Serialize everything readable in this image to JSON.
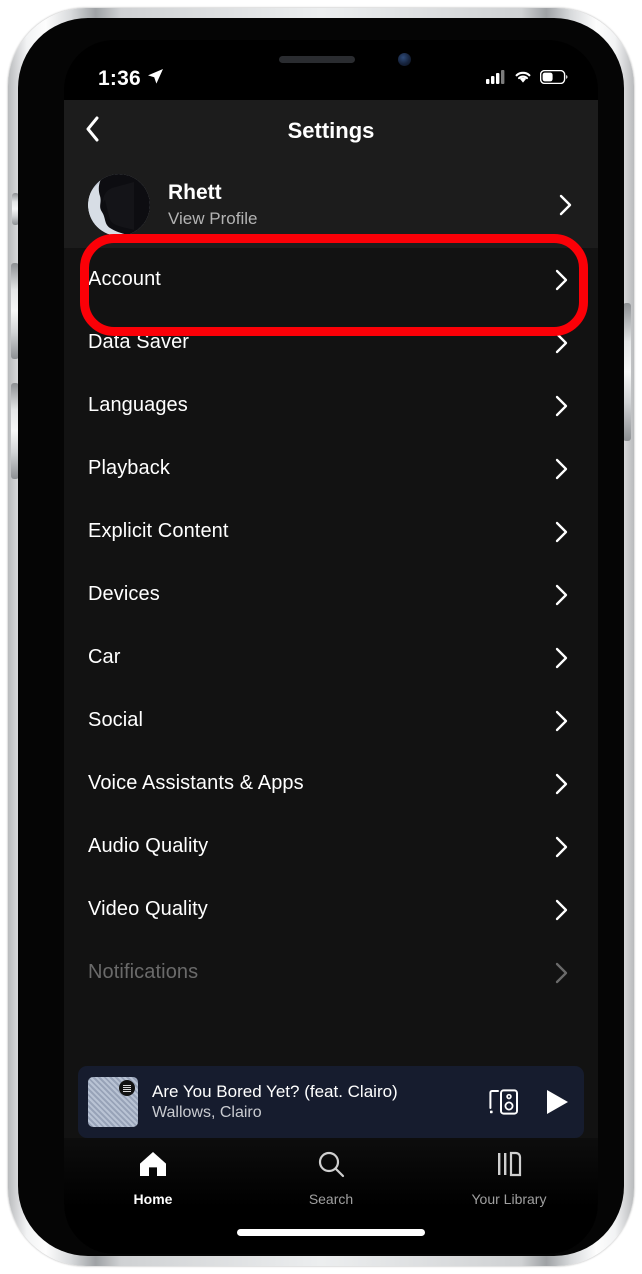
{
  "status_bar": {
    "time": "1:36",
    "location_icon": "location-arrow-icon",
    "cellular_icon": "cellular-bars-icon",
    "wifi_icon": "wifi-icon",
    "battery_icon": "battery-icon",
    "cellular_bars_filled": 3,
    "cellular_bars_total": 4,
    "battery_level_percent": 45
  },
  "nav": {
    "back_icon": "back-chevron-icon",
    "title": "Settings"
  },
  "profile": {
    "name": "Rhett",
    "subtitle": "View Profile",
    "avatar_icon": "avatar-silhouette",
    "chevron_icon": "chevron-right-icon"
  },
  "annotation": {
    "type": "highlight-rounded-rect",
    "color": "#fb0007",
    "target": "profile-row"
  },
  "settings": {
    "items": [
      {
        "label": "Account"
      },
      {
        "label": "Data Saver"
      },
      {
        "label": "Languages"
      },
      {
        "label": "Playback"
      },
      {
        "label": "Explicit Content"
      },
      {
        "label": "Devices"
      },
      {
        "label": "Car"
      },
      {
        "label": "Social"
      },
      {
        "label": "Voice Assistants & Apps"
      },
      {
        "label": "Audio Quality"
      },
      {
        "label": "Video Quality"
      },
      {
        "label": "Notifications"
      }
    ],
    "chevron_icon": "chevron-right-icon"
  },
  "now_playing": {
    "title": "Are You Bored Yet? (feat. Clairo)",
    "artist": "Wallows, Clairo",
    "album_art_icon": "album-artwork",
    "connect_icon": "connect-to-device-icon",
    "play_icon": "play-icon",
    "background_color": "#161c2e"
  },
  "tab_bar": {
    "items": [
      {
        "label": "Home",
        "icon": "home-icon",
        "active": true
      },
      {
        "label": "Search",
        "icon": "search-icon",
        "active": false
      },
      {
        "label": "Your Library",
        "icon": "your-library-icon",
        "active": false
      }
    ]
  }
}
